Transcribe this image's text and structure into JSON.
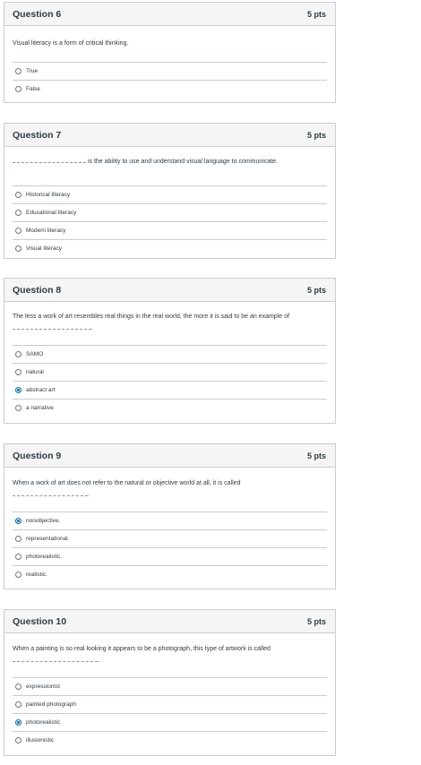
{
  "questions": [
    {
      "title": "Question 6",
      "points": "5 pts",
      "text_before": "Visual literacy is a form of critical thinking.",
      "text_after": "",
      "answers": [
        {
          "label": "True",
          "selected": false
        },
        {
          "label": "False",
          "selected": false
        }
      ]
    },
    {
      "title": "Question 7",
      "points": "5 pts",
      "text_before": "",
      "text_after": " is the ability to use and understand visual language to communicate.",
      "answers": [
        {
          "label": "Historical literacy",
          "selected": false
        },
        {
          "label": "Educational literacy",
          "selected": false
        },
        {
          "label": "Modern literacy",
          "selected": false
        },
        {
          "label": "Visual literacy",
          "selected": false
        }
      ]
    },
    {
      "title": "Question 8",
      "points": "5 pts",
      "text_before": "The less a work of art resembles real things in the real world, the more it is said to be an example of",
      "text_after": ".",
      "answers": [
        {
          "label": "SAMO",
          "selected": false
        },
        {
          "label": "natural",
          "selected": false
        },
        {
          "label": "abstract art",
          "selected": true
        },
        {
          "label": "a narrative",
          "selected": false
        }
      ]
    },
    {
      "title": "Question 9",
      "points": "5 pts",
      "text_before": "When a work of art does not refer to the natural or objective world at all, it is called",
      "text_after": ".",
      "answers": [
        {
          "label": "nonobjective.",
          "selected": true
        },
        {
          "label": "representational.",
          "selected": false
        },
        {
          "label": "photorealistic.",
          "selected": false
        },
        {
          "label": "realistic.",
          "selected": false
        }
      ]
    },
    {
      "title": "Question 10",
      "points": "5 pts",
      "text_before": "When a painting is so real looking it appears to be a photograph, this type of artwork is called",
      "text_after": ".",
      "answers": [
        {
          "label": "expressionist",
          "selected": false
        },
        {
          "label": "painted photograph",
          "selected": false
        },
        {
          "label": "photorealistic",
          "selected": false
        },
        {
          "label": "illusionistic",
          "selected": false
        }
      ]
    }
  ]
}
